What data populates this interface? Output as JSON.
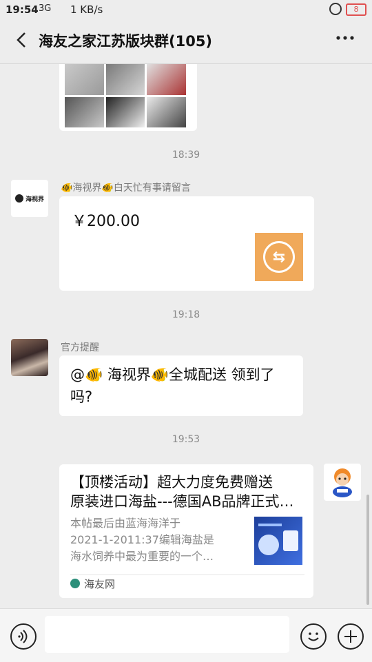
{
  "status_bar": {
    "time": "19:54",
    "signal": "3G",
    "network_speed": "1 KB/s",
    "battery": "8"
  },
  "header": {
    "title": "海友之家江苏版块群(105)",
    "back_icon": "chevron-left-icon",
    "more_icon": "more-horizontal-icon"
  },
  "messages": {
    "timestamp_1": "18:39",
    "payment": {
      "sender": "🐠海视界🐠白天忙有事请留言",
      "avatar_label": "海视界",
      "amount": "￥200.00",
      "icon": "transfer-icon"
    },
    "timestamp_2": "19:18",
    "text_message": {
      "sender": "官方提醒",
      "content": "@🐠 海视界🐠全城配送  领到了吗?"
    },
    "timestamp_3": "19:53",
    "link_card": {
      "title_line1": "【顶楼活动】超大力度免费赠送",
      "title_line2": "原装进口海盐---德国AB品牌正式…",
      "desc_line1": "本帖最后由蓝海海洋于",
      "desc_line2": "2021-1-2011:37编辑海盐是",
      "desc_line3": "海水饲养中最为重要的一个…",
      "source": "海友网"
    }
  },
  "input_bar": {
    "voice_icon": "voice-icon",
    "emoji_icon": "emoji-icon",
    "add_icon": "plus-icon",
    "placeholder": ""
  }
}
